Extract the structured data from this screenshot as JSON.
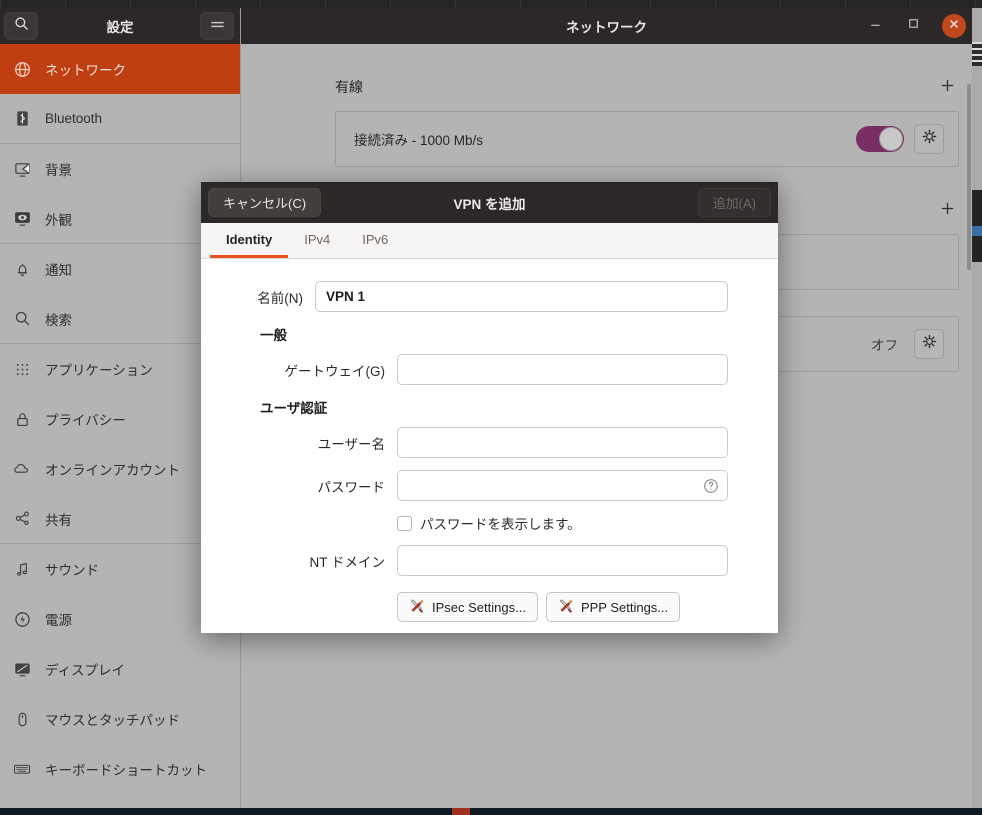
{
  "settings_window": {
    "sidebar": {
      "header": {
        "title": "設定",
        "search_icon": "search-icon",
        "menu_icon": "hamburger-menu-icon"
      },
      "items": [
        {
          "label": "ネットワーク",
          "icon": "globe-icon",
          "active": true
        },
        {
          "label": "Bluetooth",
          "icon": "bluetooth-icon",
          "active": false
        },
        {
          "label": "背景",
          "icon": "wallpaper-icon",
          "active": false
        },
        {
          "label": "外観",
          "icon": "appearance-icon",
          "active": false
        },
        {
          "label": "通知",
          "icon": "bell-icon",
          "active": false
        },
        {
          "label": "検索",
          "icon": "search-icon",
          "active": false
        },
        {
          "label": "アプリケーション",
          "icon": "grid-apps-icon",
          "active": false
        },
        {
          "label": "プライバシー",
          "icon": "lock-icon",
          "active": false
        },
        {
          "label": "オンラインアカウント",
          "icon": "cloud-icon",
          "active": false
        },
        {
          "label": "共有",
          "icon": "share-icon",
          "active": false
        },
        {
          "label": "サウンド",
          "icon": "music-note-icon",
          "active": false
        },
        {
          "label": "電源",
          "icon": "power-icon",
          "active": false
        },
        {
          "label": "ディスプレイ",
          "icon": "display-icon",
          "active": false
        },
        {
          "label": "マウスとタッチパッド",
          "icon": "mouse-icon",
          "active": false
        },
        {
          "label": "キーボードショートカット",
          "icon": "keyboard-icon",
          "active": false
        }
      ]
    },
    "titlebar": {
      "title": "ネットワーク",
      "minimize_icon": "minimize-icon",
      "maximize_icon": "maximize-icon",
      "close_icon": "close-icon"
    },
    "content": {
      "sections": [
        {
          "title": "有線",
          "add_label": "+",
          "rows": [
            {
              "text": "接続済み - 1000 Mb/s",
              "toggle": "on",
              "gear": "gear-icon"
            }
          ]
        },
        {
          "title": "",
          "add_label": "+",
          "rows": []
        },
        {
          "title": "",
          "add_label": "",
          "rows": [
            {
              "text": "",
              "state": "オフ",
              "gear": "gear-icon"
            }
          ]
        }
      ]
    }
  },
  "dialog": {
    "titlebar": {
      "cancel_label": "キャンセル(C)",
      "title": "VPN を追加",
      "add_label": "追加(A)"
    },
    "tabs": [
      {
        "label": "Identity",
        "active": true
      },
      {
        "label": "IPv4",
        "active": false
      },
      {
        "label": "IPv6",
        "active": false
      }
    ],
    "fields": {
      "name_label": "名前(N)",
      "name_value": "VPN 1",
      "name_placeholder": "",
      "general_group": "一般",
      "gateway_label": "ゲートウェイ(G)",
      "gateway_value": "",
      "gateway_placeholder": "",
      "auth_group": "ユーザ認証",
      "username_label": "ユーザー名",
      "username_value": "",
      "username_placeholder": "",
      "password_label": "パスワード",
      "password_value": "",
      "password_placeholder": "",
      "password_help_icon": "help-circle-icon",
      "show_password_label": "パスワードを表示します。",
      "show_password_checked": false,
      "ntdomain_label": "NT ドメイン",
      "ntdomain_value": "",
      "ntdomain_placeholder": ""
    },
    "buttons": [
      {
        "label": "IPsec Settings...",
        "icon": "tools-icon"
      },
      {
        "label": "PPP Settings...",
        "icon": "tools-icon"
      }
    ]
  },
  "colors": {
    "accent_orange": "#e8531d",
    "sidebar_selected": "#bf3e12",
    "toggle_on": "#7a2f64",
    "close_button": "#c1471c",
    "titlebar_dark": "#2b2827"
  }
}
